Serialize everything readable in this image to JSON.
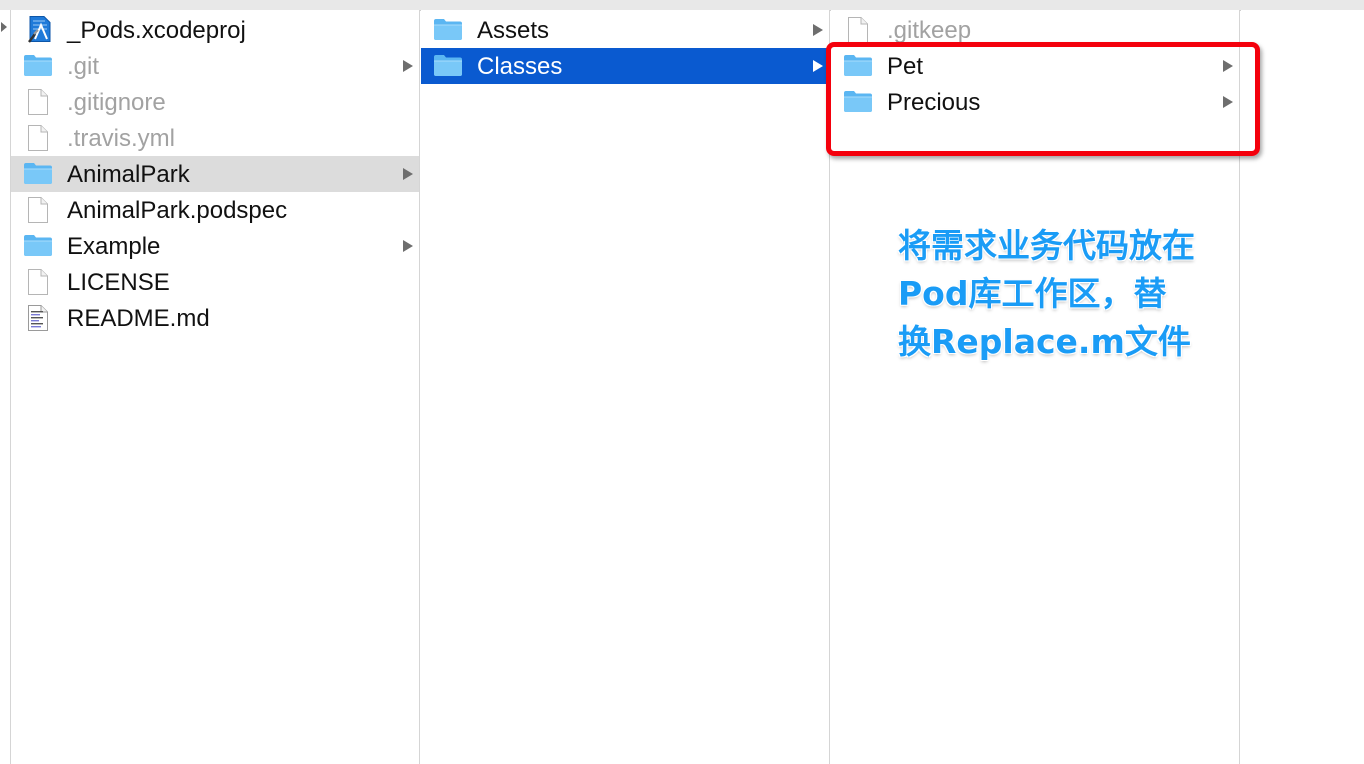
{
  "columns": {
    "col1": [
      {
        "name": "_Pods.xcodeproj",
        "kind": "xcodeproj",
        "dim": false,
        "has_children": false
      },
      {
        "name": ".git",
        "kind": "folder",
        "dim": true,
        "has_children": true
      },
      {
        "name": ".gitignore",
        "kind": "file",
        "dim": true,
        "has_children": false
      },
      {
        "name": ".travis.yml",
        "kind": "file",
        "dim": true,
        "has_children": false
      },
      {
        "name": "AnimalPark",
        "kind": "folder",
        "dim": false,
        "has_children": true,
        "selected": "inactive"
      },
      {
        "name": "AnimalPark.podspec",
        "kind": "file",
        "dim": false,
        "has_children": false
      },
      {
        "name": "Example",
        "kind": "folder",
        "dim": false,
        "has_children": true
      },
      {
        "name": "LICENSE",
        "kind": "file",
        "dim": false,
        "has_children": false
      },
      {
        "name": "README.md",
        "kind": "textfile",
        "dim": false,
        "has_children": false
      }
    ],
    "col2": [
      {
        "name": "Assets",
        "kind": "folder",
        "dim": false,
        "has_children": true
      },
      {
        "name": "Classes",
        "kind": "folder",
        "dim": false,
        "has_children": true,
        "selected": "active"
      }
    ],
    "col3": [
      {
        "name": ".gitkeep",
        "kind": "file",
        "dim": true,
        "has_children": false
      },
      {
        "name": "Pet",
        "kind": "folder",
        "dim": false,
        "has_children": true
      },
      {
        "name": "Precious",
        "kind": "folder",
        "dim": false,
        "has_children": true
      }
    ]
  },
  "annotation": {
    "text": "将需求业务代码放在Pod库工作区，替换Replace.m文件",
    "color": "#1a9cf6"
  },
  "highlight": {
    "color": "#f4000c"
  },
  "colors": {
    "selection_active": "#0a5ad0",
    "selection_inactive": "#dcdcdc",
    "folder": "#6ec2f5"
  }
}
